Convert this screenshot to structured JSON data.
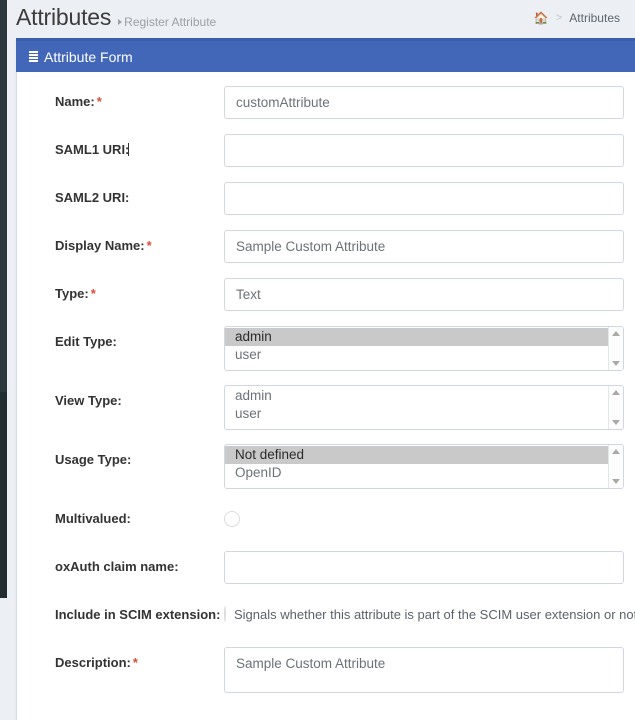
{
  "header": {
    "title": "Attributes",
    "subtitle": "Register Attribute",
    "breadcrumb": {
      "home_icon": "home-icon",
      "separator": ">",
      "current": "Attributes"
    }
  },
  "panel": {
    "icon": "th-list-icon",
    "title": "Attribute Form"
  },
  "form": {
    "fields": [
      {
        "label": "Name:",
        "required": true,
        "type": "text",
        "value": "customAttribute"
      },
      {
        "label": "SAML1 URI:",
        "required": false,
        "type": "text",
        "value": "",
        "cursor": true
      },
      {
        "label": "SAML2 URI:",
        "required": false,
        "type": "text",
        "value": ""
      },
      {
        "label": "Display Name:",
        "required": true,
        "type": "text",
        "value": "Sample Custom Attribute"
      },
      {
        "label": "Type:",
        "required": true,
        "type": "text",
        "value": "Text"
      },
      {
        "label": "Edit Type:",
        "required": false,
        "type": "listbox",
        "options": [
          "admin",
          "user"
        ],
        "selected": [
          "admin"
        ]
      },
      {
        "label": "View Type:",
        "required": false,
        "type": "listbox",
        "options": [
          "admin",
          "user"
        ],
        "selected": []
      },
      {
        "label": "Usage Type:",
        "required": false,
        "type": "listbox",
        "options": [
          "Not defined",
          "OpenID"
        ],
        "selected": [
          "Not defined"
        ]
      },
      {
        "label": "Multivalued:",
        "required": false,
        "type": "radio",
        "checked": false,
        "helper": ""
      },
      {
        "label": "oxAuth claim name:",
        "required": false,
        "type": "text",
        "value": ""
      },
      {
        "label": "Include in SCIM extension:",
        "required": false,
        "type": "radio",
        "checked": false,
        "helper": "Signals whether this attribute is part of the SCIM user extension or not."
      },
      {
        "label": "Description:",
        "required": true,
        "type": "textarea",
        "value": "Sample Custom Attribute"
      }
    ]
  },
  "colors": {
    "panel_header": "#4267b8",
    "page_background": "#ecf0f5",
    "sidebar": "#222d32",
    "required_asterisk": "#dd4b39",
    "selected_option": "#c9c9c9"
  }
}
